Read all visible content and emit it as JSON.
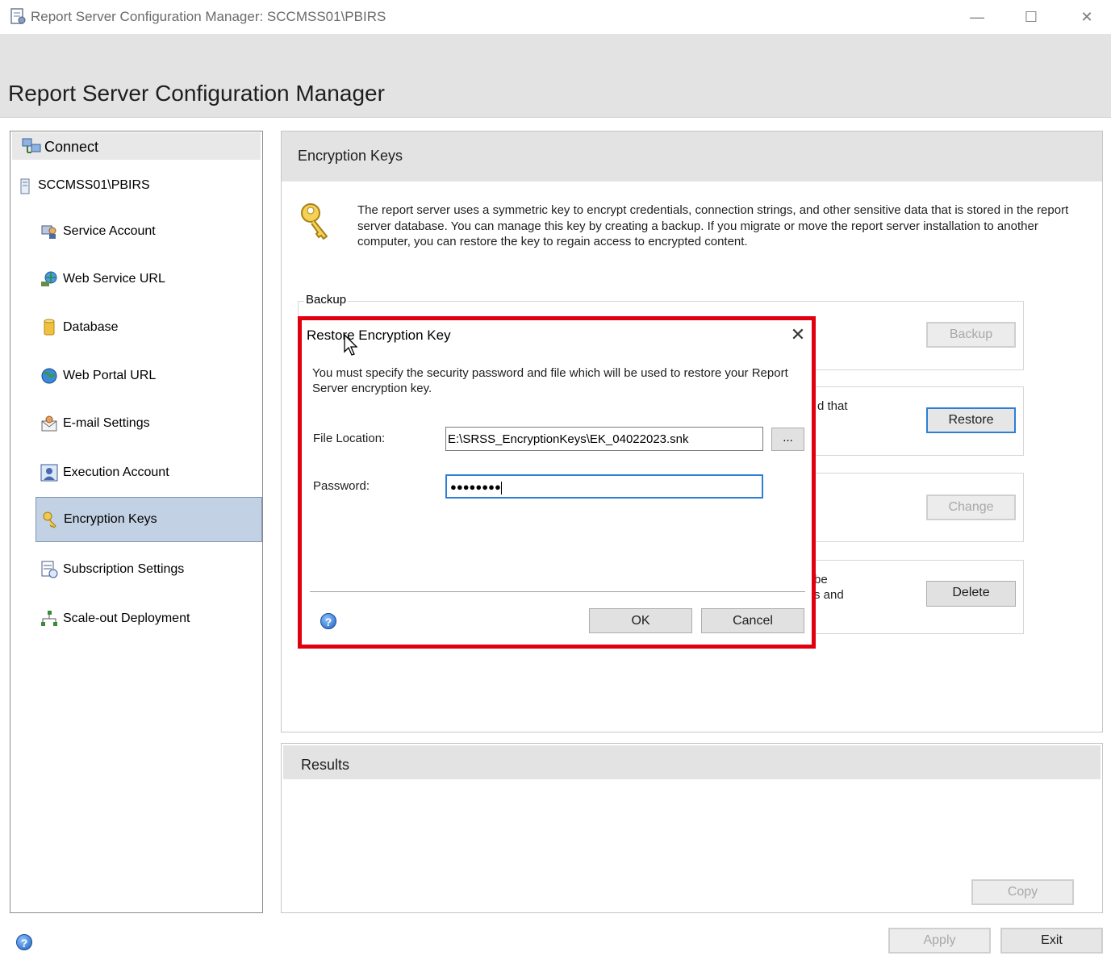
{
  "window": {
    "title": "Report Server Configuration Manager: SCCMSS01\\PBIRS",
    "minimize_glyph": "—",
    "maximize_glyph": "☐",
    "close_glyph": "✕"
  },
  "header": {
    "title": "Report Server Configuration Manager"
  },
  "sidebar": {
    "connect_label": "Connect",
    "server_label": "SCCMSS01\\PBIRS",
    "items": [
      {
        "label": "Service Account",
        "icon": "service-account-icon"
      },
      {
        "label": "Web Service URL",
        "icon": "web-service-url-icon"
      },
      {
        "label": "Database",
        "icon": "database-icon"
      },
      {
        "label": "Web Portal URL",
        "icon": "globe-icon"
      },
      {
        "label": "E-mail Settings",
        "icon": "email-icon"
      },
      {
        "label": "Execution Account",
        "icon": "execution-account-icon"
      },
      {
        "label": "Encryption Keys",
        "icon": "key-icon",
        "selected": true
      },
      {
        "label": "Subscription Settings",
        "icon": "subscription-icon"
      },
      {
        "label": "Scale-out Deployment",
        "icon": "scale-out-icon"
      }
    ]
  },
  "main": {
    "title": "Encryption Keys",
    "description": "The report server uses a symmetric key to encrypt credentials, connection strings, and other sensitive data that is stored in the report server database.  You can manage this key by creating a backup.  If you migrate or move the report server installation to another computer, you can restore the key to regain access to encrypted content.",
    "backup_group_title": "Backup",
    "backup_button": "Backup",
    "restore_peek": "d that",
    "restore_button": "Restore",
    "change_button": "Change",
    "delete_peek_1": "be",
    "delete_peek_2": "s and",
    "delete_button": "Delete"
  },
  "results": {
    "title": "Results",
    "copy_button": "Copy"
  },
  "footer": {
    "help_glyph": "?",
    "apply_button": "Apply",
    "exit_button": "Exit"
  },
  "dialog": {
    "title": "Restore Encryption Key",
    "close_glyph": "✕",
    "message": "You must specify the security password and file which will be used to restore your Report Server encryption key.",
    "file_location_label": "File Location:",
    "file_location_value": "E:\\SRSS_EncryptionKeys\\EK_04022023.snk",
    "browse_button": "...",
    "password_label": "Password:",
    "password_value": "●●●●●●●●",
    "ok_button": "OK",
    "cancel_button": "Cancel",
    "help_glyph": "?"
  }
}
